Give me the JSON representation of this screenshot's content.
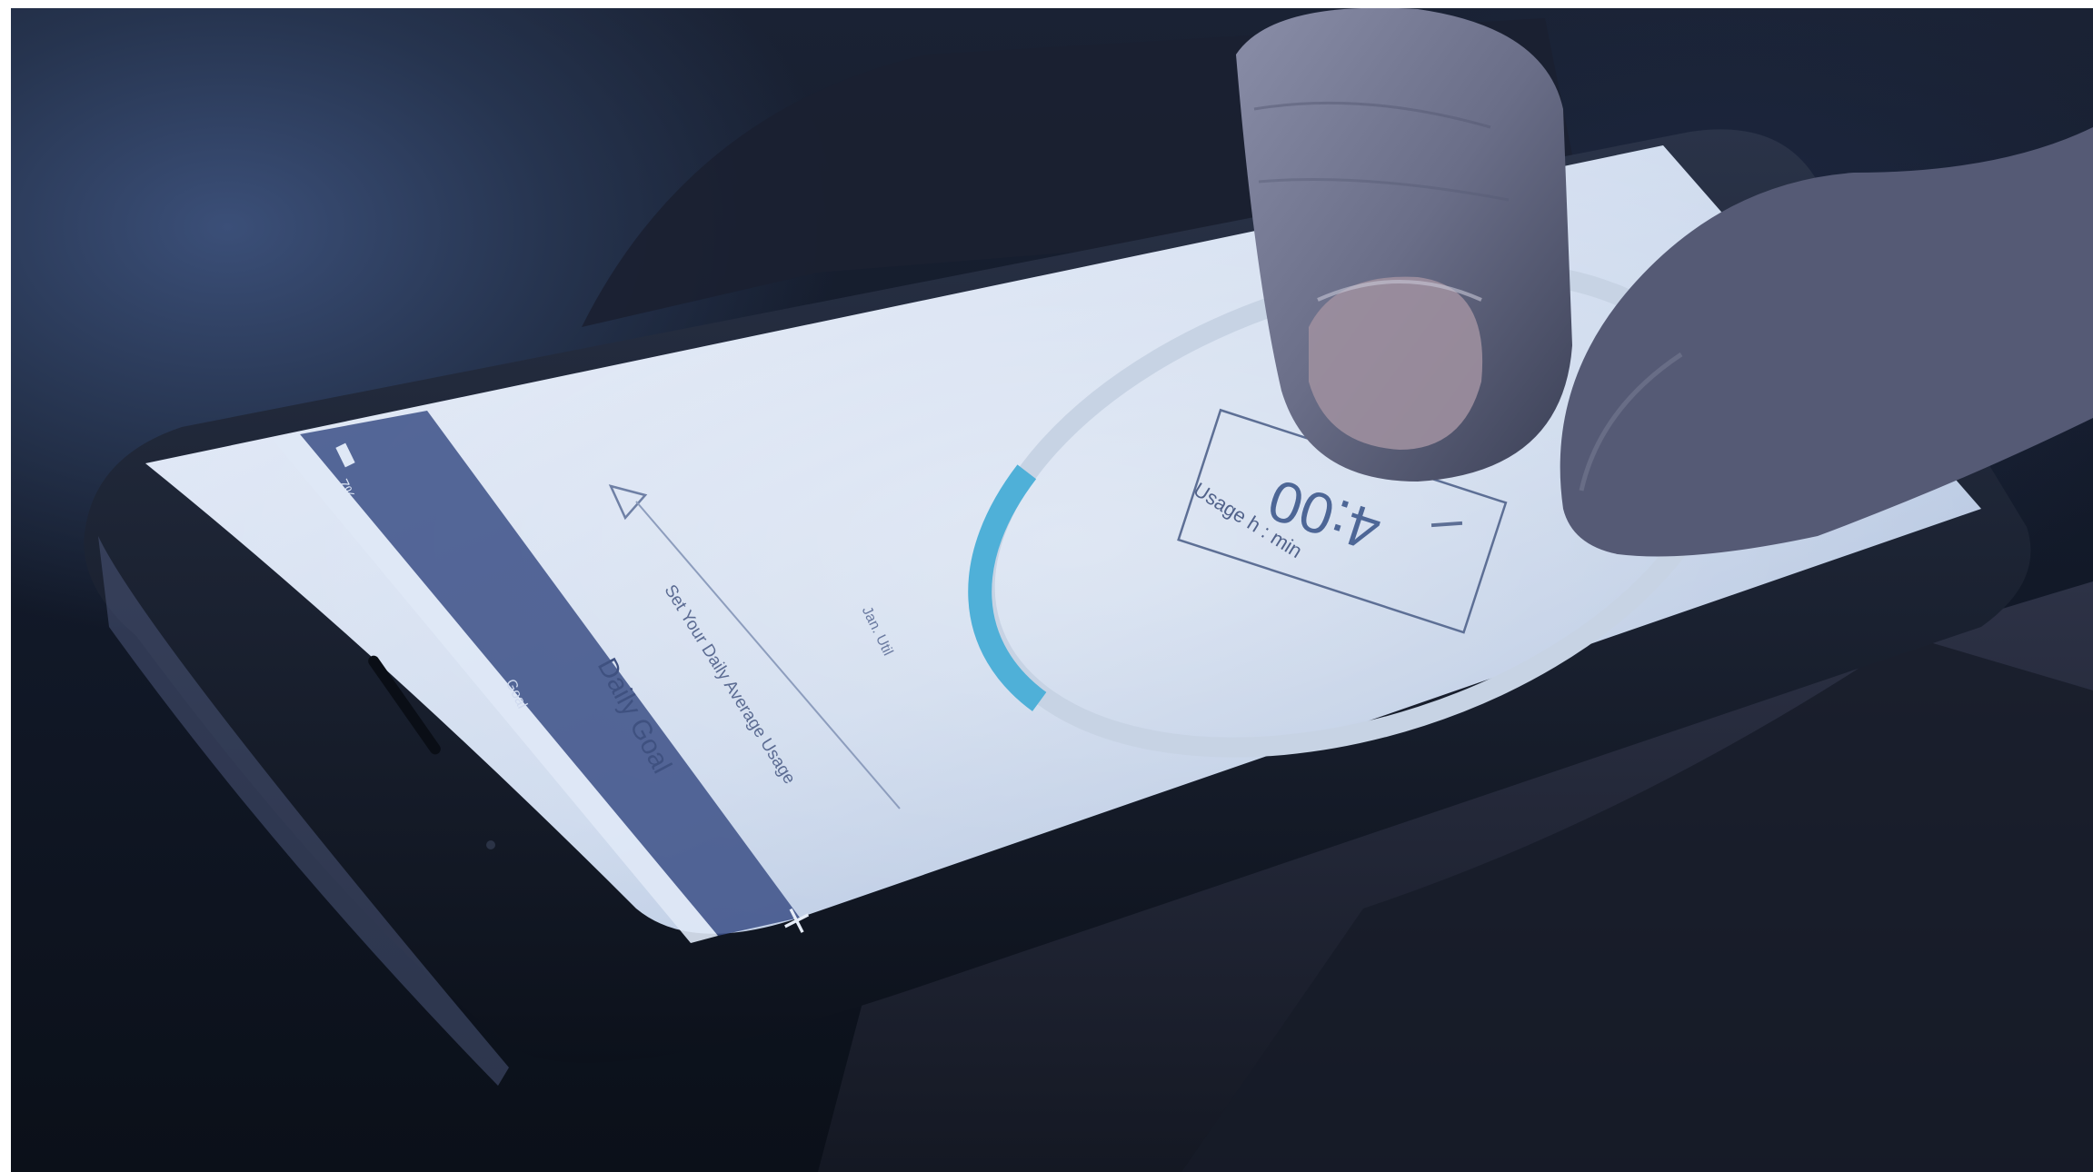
{
  "app": {
    "header_left": "7%",
    "header_middle": "Goal",
    "close_glyph": "×",
    "goal_title": "Daily Goal",
    "goal_subtitle": "Set Your Daily Average Usage",
    "timer_value": "4:00",
    "timer_unit_label": "Usage h : min",
    "arc_side_label": "Jan. Util",
    "progress_fraction": 0.14
  },
  "colors": {
    "accent": "#4fb0d8",
    "screen": "#dbe6f5",
    "header_bar": "#3b4f86",
    "ring_track": "#c7d3e4"
  },
  "icons": {
    "close": "close-icon",
    "battery": "battery-icon",
    "triangle": "triangle-marker-icon"
  }
}
